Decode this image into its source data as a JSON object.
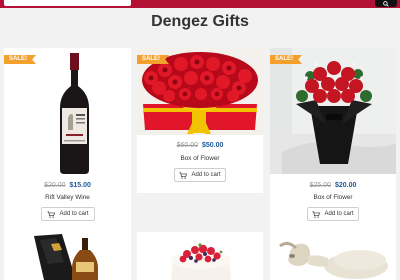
{
  "header": {
    "title": "Dengez Gifts",
    "search_placeholder": ""
  },
  "colors": {
    "topbar": "#b21135",
    "sale_badge": "#f4a02c",
    "price": "#1e5a96"
  },
  "products": [
    {
      "name": "Rift Valley Wine",
      "badge": "SALE!",
      "old_price": "$20.00",
      "new_price": "$15.00",
      "button": "Add to cart",
      "image_icon": "wine-bottle-icon"
    },
    {
      "name": "Box of Flower",
      "badge": "SALE!",
      "old_price": "$60.00",
      "new_price": "$50.00",
      "button": "Add to cart",
      "image_icon": "rose-box-icon"
    },
    {
      "name": "Box of Flower",
      "badge": "SALE!",
      "old_price": "$25.00",
      "new_price": "$20.00",
      "button": "Add to cart",
      "image_icon": "rose-bouquet-icon"
    },
    {
      "name": "",
      "image_icon": "cognac-gift-box-icon"
    },
    {
      "name": "",
      "image_icon": "berry-cake-icon"
    },
    {
      "name": "",
      "image_icon": "sheep-icon"
    }
  ]
}
